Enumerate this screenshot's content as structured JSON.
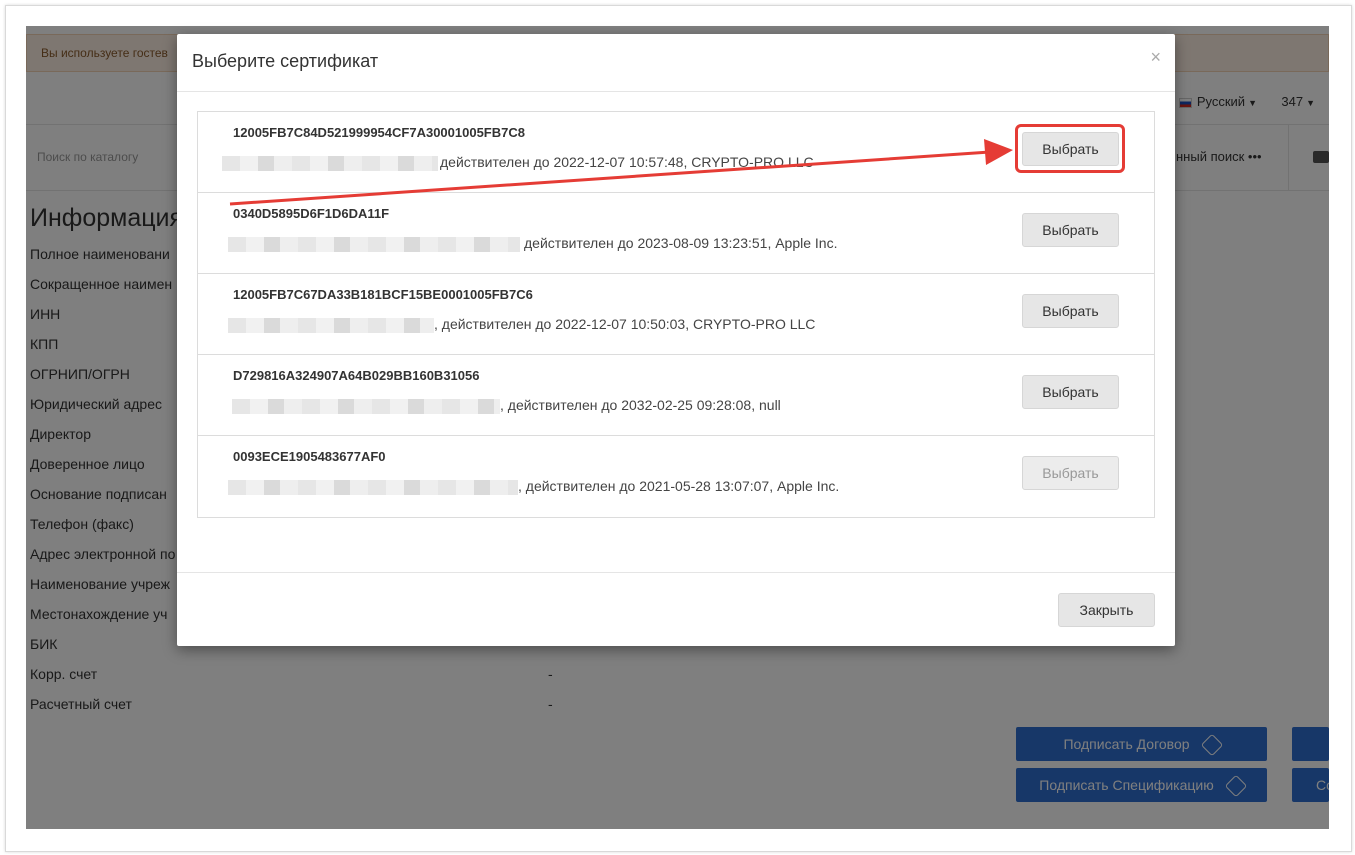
{
  "background": {
    "guest_notice": "Вы используете гостев",
    "language": "Русский",
    "user_id": "347",
    "search_placeholder": "Поиск по каталогу",
    "extended_search": "нный поиск •••",
    "info_title": "Информация",
    "info_rows": [
      "Полное наименовани",
      "Сокращенное наимен",
      "ИНН",
      "КПП",
      "ОГРНИП/ОГРН",
      "Юридический адрес",
      "Директор",
      "Доверенное лицо",
      "Основание подписан",
      "Телефон (факс)",
      "Адрес электронной по",
      "Наименование учреж",
      "Местонахождение уч",
      "БИК",
      "Корр. счет",
      "Расчетный счет"
    ],
    "corr_value": "-",
    "account_value": "-",
    "sign_contract_label": "Подписать Договор",
    "sign_spec_label": "Подписать Спецификацию",
    "right_button_partial": "Co"
  },
  "modal": {
    "title": "Выберите сертификат",
    "close_icon": "×",
    "certificates": [
      {
        "id": "12005FB7C84D521999954CF7A30001005FB7C8",
        "desc": "действителен до 2022-12-07 10:57:48, CRYPTO-PRO LLC",
        "button": "Выбрать",
        "disabled": false
      },
      {
        "id": "0340D5895D6F1D6DA11F",
        "desc": "действителен до 2023-08-09 13:23:51, Apple Inc.",
        "button": "Выбрать",
        "disabled": false
      },
      {
        "id": "12005FB7C67DA33B181BCF15BE0001005FB7C6",
        "desc": ", действителен до 2022-12-07 10:50:03, CRYPTO-PRO LLC",
        "button": "Выбрать",
        "disabled": false
      },
      {
        "id": "D729816A324907A64B029BB160B31056",
        "desc": ", действителен до 2032-02-25 09:28:08, null",
        "button": "Выбрать",
        "disabled": false
      },
      {
        "id": "0093ECE1905483677AF0",
        "desc": ", действителен до 2021-05-28 13:07:07, Apple Inc.",
        "button": "Выбрать",
        "disabled": true
      }
    ],
    "close_button": "Закрыть"
  },
  "colors": {
    "highlight": "#e53c35",
    "primary_button": "#2f6ed0"
  }
}
